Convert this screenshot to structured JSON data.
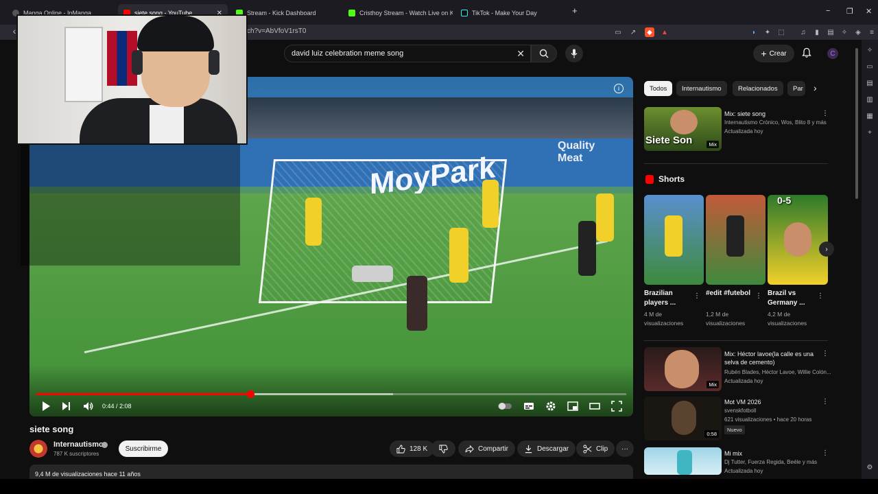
{
  "tabs": [
    {
      "title": "Manga Online - InManga",
      "fav_color": "#555555"
    },
    {
      "title": "siete song - YouTube",
      "fav_color": "#ff0000"
    },
    {
      "title": "Stream - Kick Dashboard",
      "fav_color": "#53fc18"
    },
    {
      "title": "Cristhoy Stream - Watch Live on Kick",
      "fav_color": "#53fc18"
    },
    {
      "title": "TikTok - Make Your Day",
      "fav_color": "#25f4ee"
    }
  ],
  "window": {
    "new_tab": "+",
    "minimize": "−",
    "maximize": "❐",
    "close": "✕",
    "tab_close": "✕"
  },
  "address": {
    "url": "ch?v=AbVfoV1rsT0",
    "back": "‹"
  },
  "search": {
    "query": "david luiz celebration meme song",
    "clear": "✕"
  },
  "header": {
    "create_label": "Crear",
    "create_plus": "+",
    "avatar_letter": "C"
  },
  "player": {
    "current_time": "0:44",
    "duration": "2:08",
    "time_sep": " / ",
    "progress_fraction": 0.3625,
    "buffer_fraction": 0.605,
    "ad_text": "MoyPark",
    "quality_line1": "Quality",
    "quality_line2": "Meat",
    "info": "i"
  },
  "video": {
    "title": "siete song",
    "channel": "Internautismo",
    "subscribers": "787 K suscriptores",
    "subscribe_label": "Suscribirme",
    "likes": "128 K",
    "share_label": "Compartir",
    "download_label": "Descargar",
    "clip_label": "Clip",
    "more": "···",
    "views_line": "9,4 M de visualizaciones  hace 11 años"
  },
  "chips": [
    {
      "label": "Todos",
      "active": true
    },
    {
      "label": "Internautismo",
      "active": false
    },
    {
      "label": "Relacionados",
      "active": false
    },
    {
      "label": "Par",
      "active": false
    }
  ],
  "chips_next": "›",
  "recommended": [
    {
      "title": "Mix: siete song",
      "meta1": "Internautismo Crónico, Wos, Blito 8 y más",
      "meta2": "Actualizada hoy",
      "badge": "Mix",
      "overlay": "Siete Son"
    },
    {
      "title": "Mix: Héctor lavoe(la calle es una selva de cemento)",
      "meta1": "Rubén Blades, Héctor Lavoe, Willie Colón...",
      "meta2": "Actualizada hoy",
      "badge": "Mix"
    },
    {
      "title": "Mot VM 2026",
      "meta1": "svenskfotboll",
      "meta2": "621 visualizaciones • hace 20 horas",
      "tag": "Nuevo",
      "badge": "0:58"
    },
    {
      "title": "Mi mix",
      "meta1": "Dj Tutter, Fuerza Regida, Beéle y más",
      "meta2": "Actualizada hoy"
    }
  ],
  "more_dots": "⋮",
  "shorts": {
    "heading": "Shorts",
    "next": "›",
    "items": [
      {
        "title": "Brazilian players ...",
        "views": "4 M de visualizaciones"
      },
      {
        "title": "#edit #futebol",
        "views": "1,2 M de visualizaciones"
      },
      {
        "title": "Brazil vs Germany ...",
        "views": "4,2 M de visualizaciones",
        "overlay": "0-5"
      }
    ]
  }
}
